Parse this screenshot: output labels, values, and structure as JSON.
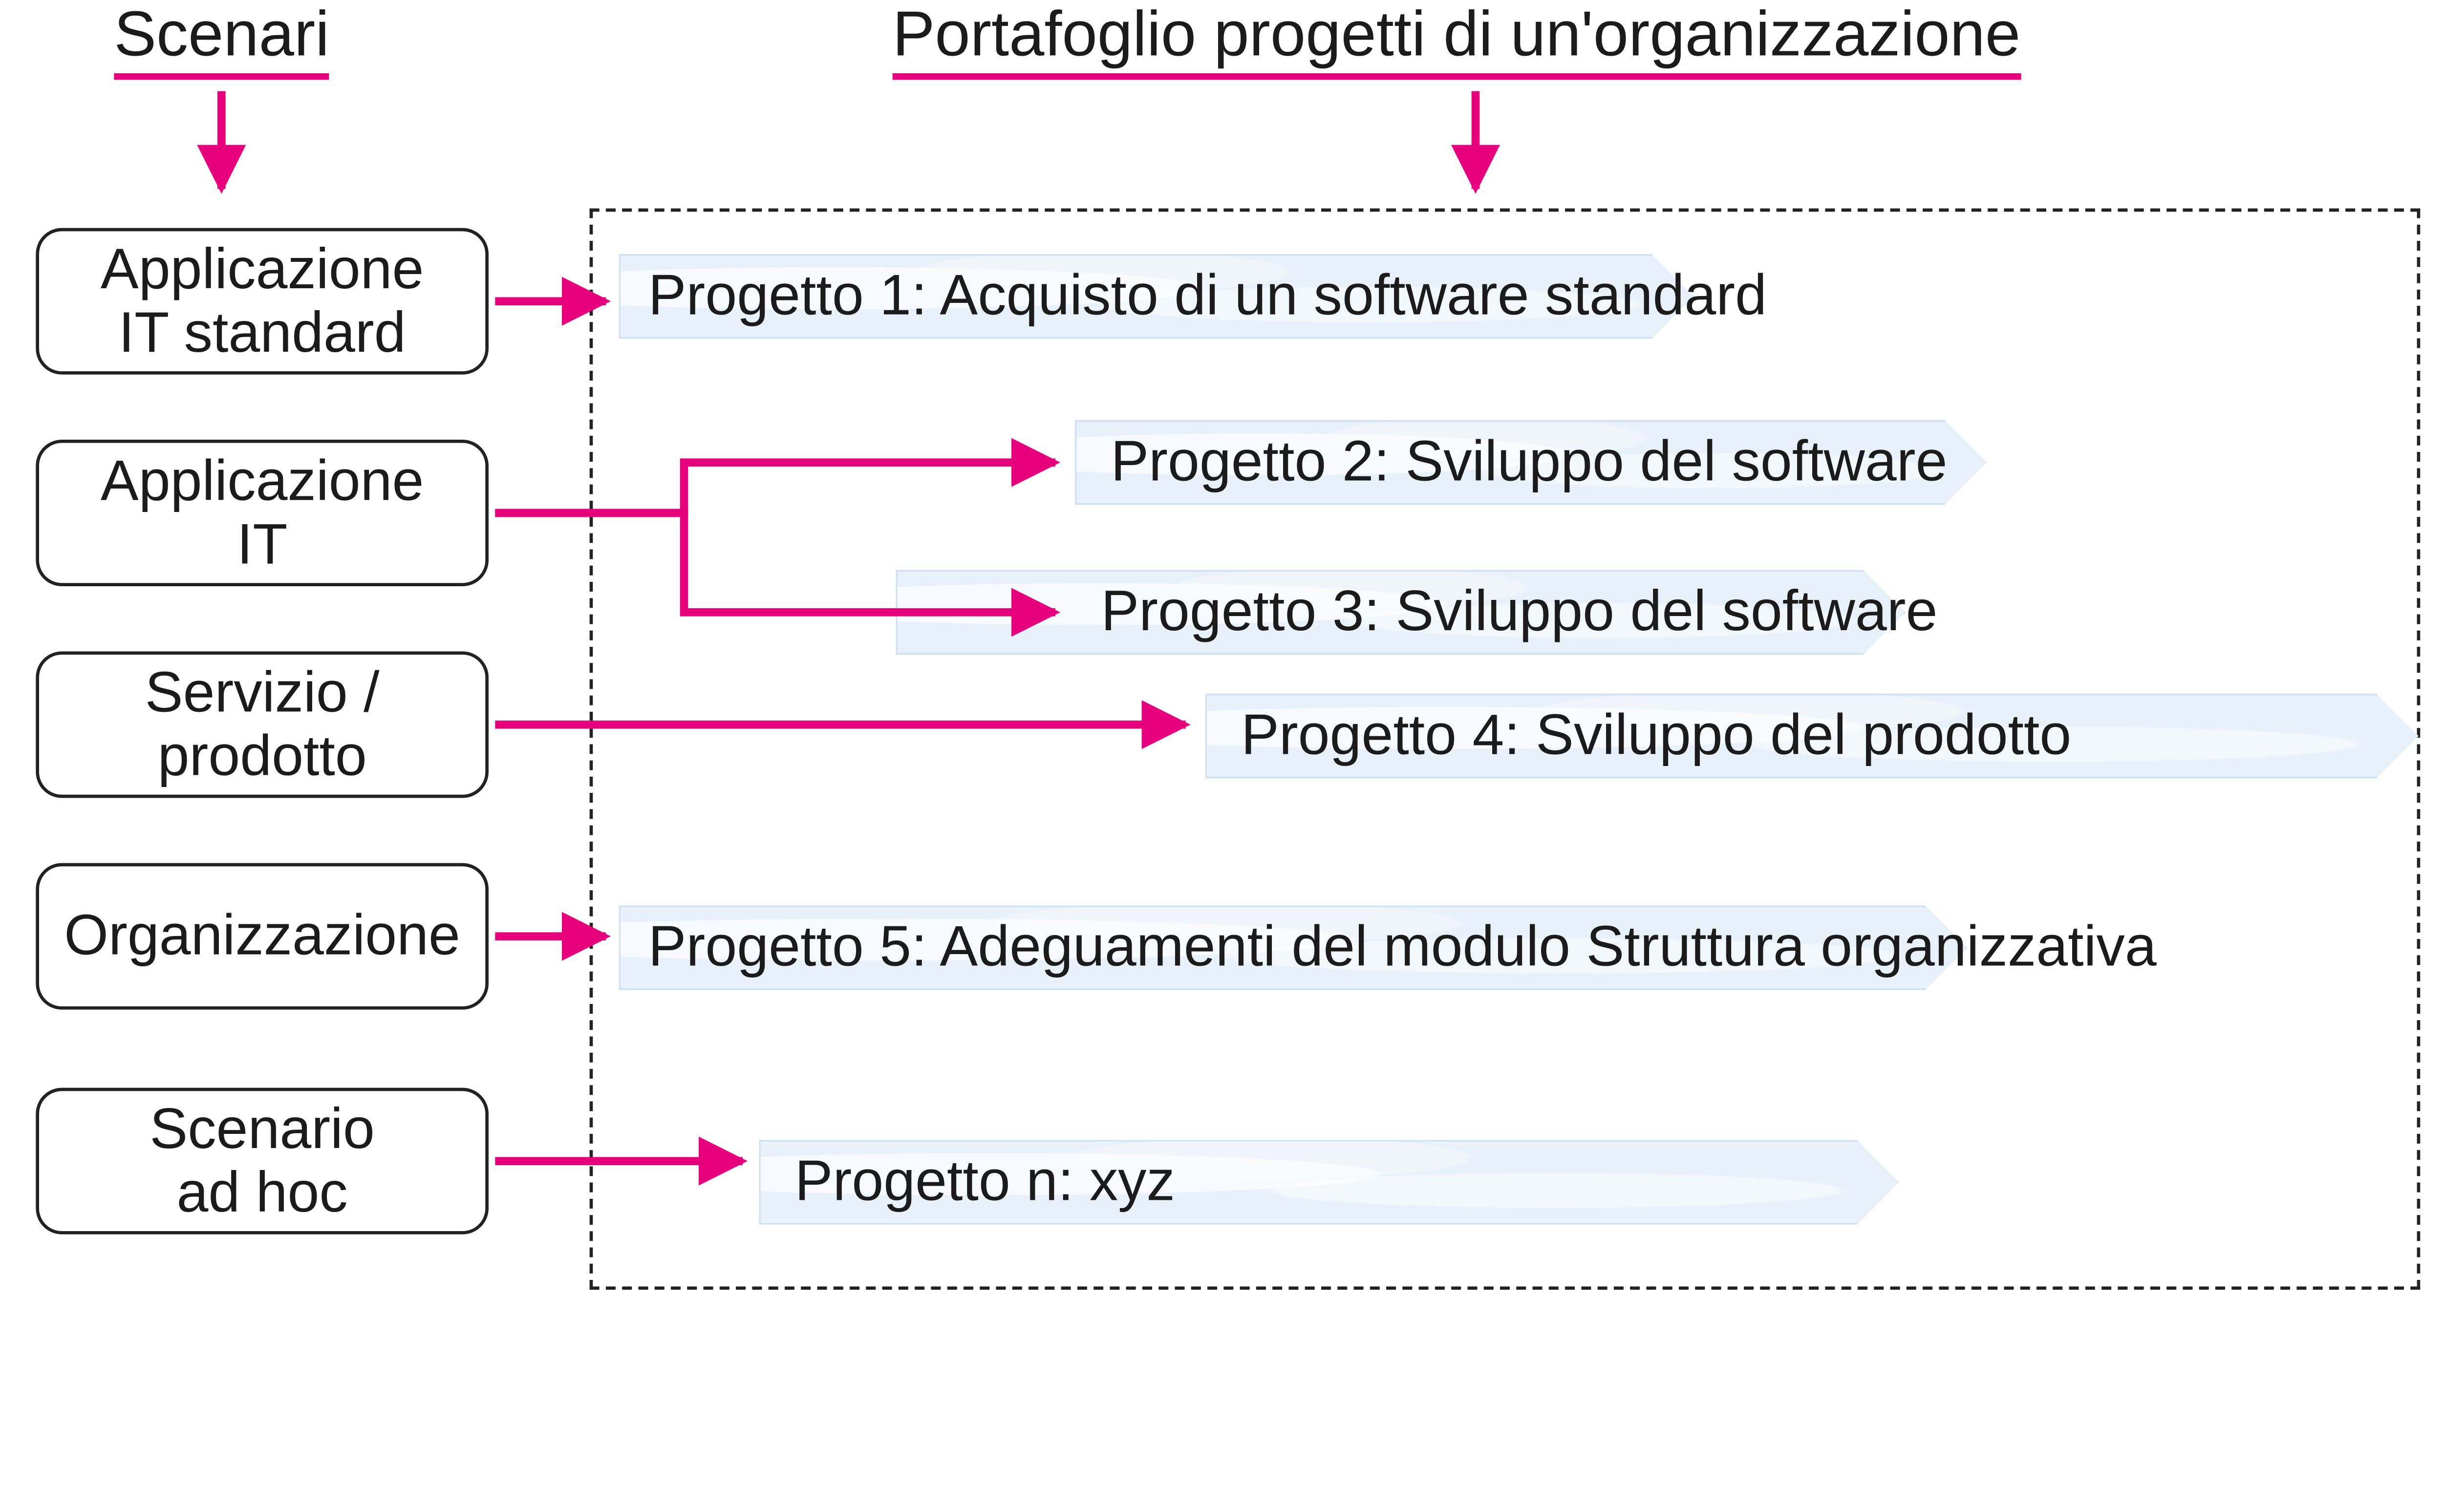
{
  "colors": {
    "accent": "#e6007e",
    "barFill": "#e8f0fa",
    "barStroke": "#cfe0f2",
    "text": "#1b1b1b",
    "boxStroke": "#222222"
  },
  "headings": {
    "scenarios": "Scenari",
    "portfolio": "Portafoglio progetti di un'organizzazione"
  },
  "scenarios": {
    "it_standard": "Applicazione\nIT standard",
    "it": "Applicazione\nIT",
    "service_product": "Servizio /\nprodotto",
    "organization": "Organizzazione",
    "adhoc": "Scenario\nad hoc"
  },
  "projects": {
    "p1": "Progetto 1: Acquisto di un software standard",
    "p2": "Progetto 2: Sviluppo del software",
    "p3": "Progetto 3: Sviluppo del software",
    "p4": "Progetto 4: Sviluppo del prodotto",
    "p5": "Progetto 5: Adeguamenti del modulo Struttura organizzativa",
    "pn": "Progetto n: xyz"
  }
}
